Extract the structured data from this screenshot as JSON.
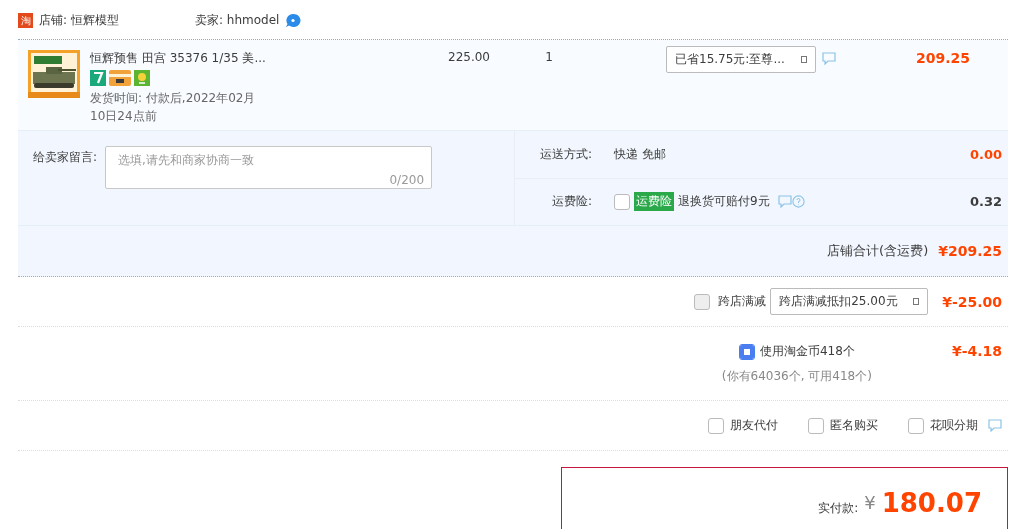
{
  "shop": {
    "logo": "淘",
    "name": "店铺: 恒辉模型",
    "seller": "卖家: hhmodel"
  },
  "item": {
    "title": "恒辉预售 田宫 35376 1/35 美...",
    "delivery": "发货时间: 付款后,2022年02月10日24点前",
    "price": "225.00",
    "quantity": "1",
    "promo": "已省15.75元:至尊...",
    "subtotal": "209.25"
  },
  "message": {
    "label": "给卖家留言:",
    "placeholder": "选填,请先和商家协商一致",
    "counter": "0/200"
  },
  "shipping": {
    "label": "运送方式:",
    "value": "快递 免邮",
    "fee": "0.00"
  },
  "insurance": {
    "label": "运费险:",
    "checked": false,
    "tag": "运费险",
    "text": "退换货可赔付9元",
    "fee": "0.32"
  },
  "store_total": {
    "label": "店铺合计(含运费)",
    "amount": "¥209.25"
  },
  "cross_store": {
    "checked": false,
    "disabled": true,
    "label": "跨店满减",
    "select": "跨店满减抵扣25.00元",
    "amount": "¥-25.00"
  },
  "coins": {
    "checked": true,
    "label": "使用淘金币418个",
    "note": "(你有64036个, 可用418个)",
    "amount": "¥-4.18"
  },
  "options": [
    {
      "label": "朋友代付",
      "checked": false
    },
    {
      "label": "匿名购买",
      "checked": false
    },
    {
      "label": "花呗分期",
      "checked": false
    }
  ],
  "payment": {
    "label": "实付款:",
    "currency": "¥",
    "amount": "180.07"
  }
}
